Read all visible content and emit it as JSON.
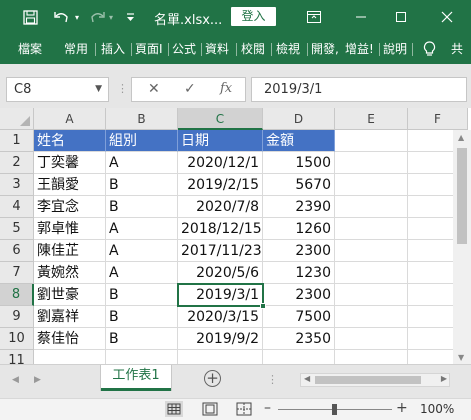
{
  "titlebar": {
    "title": "名單.xlsx...",
    "login_label": "登入",
    "icons": [
      "save-icon",
      "undo-icon",
      "redo-icon",
      "customize-qat-icon",
      "ribbon-display-icon",
      "minimize-icon",
      "maximize-icon",
      "close-icon"
    ]
  },
  "ribbon": {
    "tabs": [
      "檔案",
      "常用",
      "插入",
      "頁面I",
      "公式",
      "資料",
      "校閱",
      "檢視",
      "開發,",
      "增益!",
      "說明"
    ],
    "tell_me_icon": "lightbulb-icon",
    "share_label": "共"
  },
  "formula_bar": {
    "name_box": "C8",
    "formula": "2019/3/1",
    "fx_label": "fx"
  },
  "columns": [
    "A",
    "B",
    "C",
    "D",
    "E",
    "F"
  ],
  "rows": [
    "1",
    "2",
    "3",
    "4",
    "5",
    "6",
    "7",
    "8",
    "9",
    "10",
    "11"
  ],
  "table": {
    "headers": [
      "姓名",
      "組別",
      "日期",
      "金額"
    ],
    "records": [
      [
        "丁奕馨",
        "A",
        "2020/12/1",
        "1500"
      ],
      [
        "王韻愛",
        "B",
        "2019/2/15",
        "5670"
      ],
      [
        "李宜念",
        "B",
        "2020/7/8",
        "2390"
      ],
      [
        "郭卓惟",
        "A",
        "2018/12/15",
        "1260"
      ],
      [
        "陳佳芷",
        "A",
        "2017/11/23",
        "2300"
      ],
      [
        "黃婉然",
        "A",
        "2020/5/6",
        "1230"
      ],
      [
        "劉世豪",
        "B",
        "2019/3/1",
        "2300"
      ],
      [
        "劉嘉祥",
        "B",
        "2020/3/15",
        "7500"
      ],
      [
        "蔡佳怡",
        "B",
        "2019/9/2",
        "2350"
      ]
    ]
  },
  "selection": {
    "cell": "C8",
    "column": "C",
    "row": "8"
  },
  "sheets": {
    "tabs": [
      "工作表1"
    ],
    "active": "工作表1"
  },
  "statusbar": {
    "zoom": "100%",
    "zoom_minus": "–",
    "zoom_plus": "+"
  },
  "colors": {
    "accent": "#217346",
    "header_fill": "#4472c4"
  }
}
